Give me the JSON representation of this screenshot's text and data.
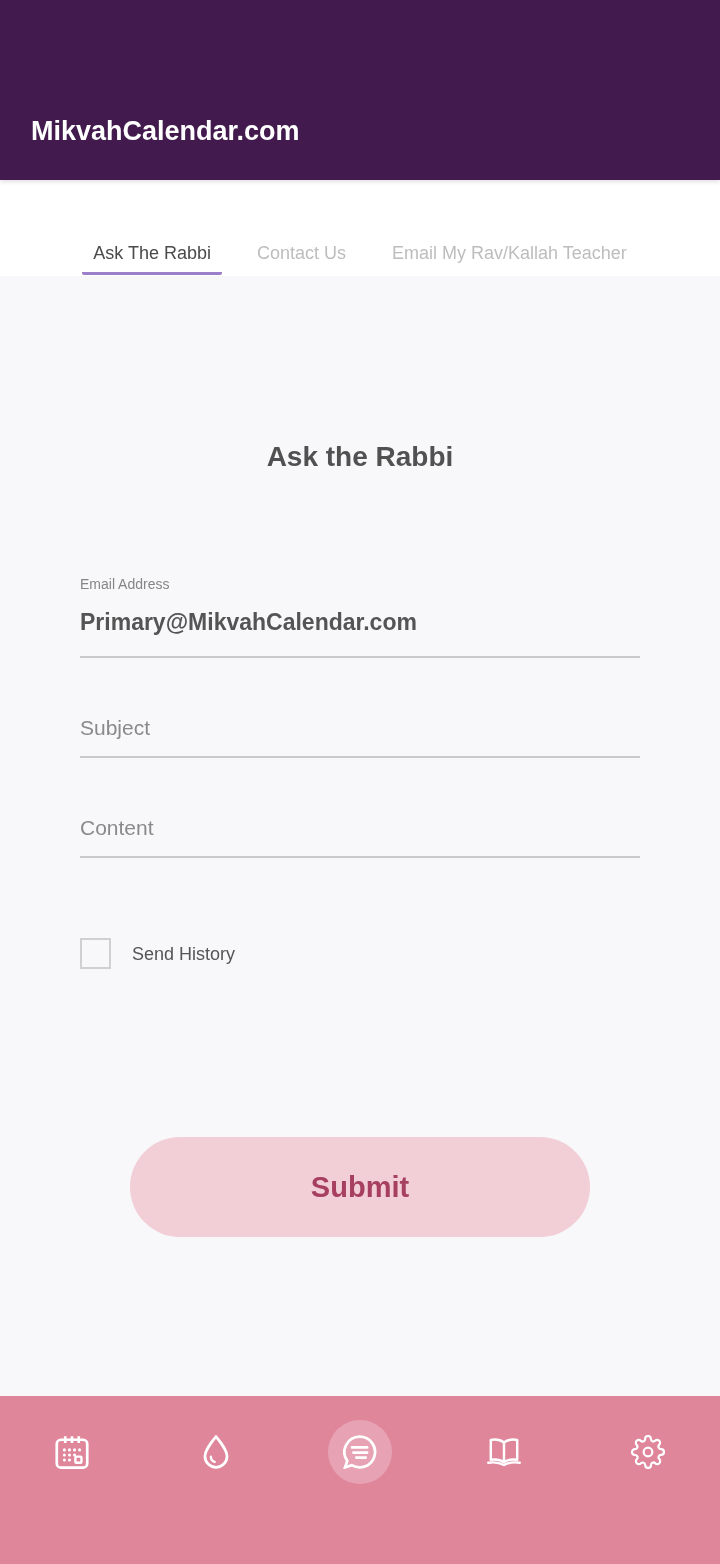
{
  "app_bar": {
    "title": "MikvahCalendar.com"
  },
  "tabs": [
    {
      "label": "Ask The Rabbi",
      "selected": true
    },
    {
      "label": "Contact Us",
      "selected": false
    },
    {
      "label": "Email My Rav/Kallah Teacher",
      "selected": false
    }
  ],
  "form": {
    "heading": "Ask the Rabbi",
    "fields": [
      {
        "label": "Email Address",
        "value": "Primary@MikvahCalendar.com"
      },
      {
        "placeholder": "Subject"
      },
      {
        "placeholder": "Content"
      }
    ],
    "send_history": {
      "label": "Send History",
      "checked": false
    },
    "submit_button": "Submit"
  },
  "bottom_nav": [
    {
      "selected": false
    },
    {
      "selected": false
    },
    {
      "selected": true
    },
    {
      "selected": false
    },
    {
      "selected": false
    }
  ]
}
